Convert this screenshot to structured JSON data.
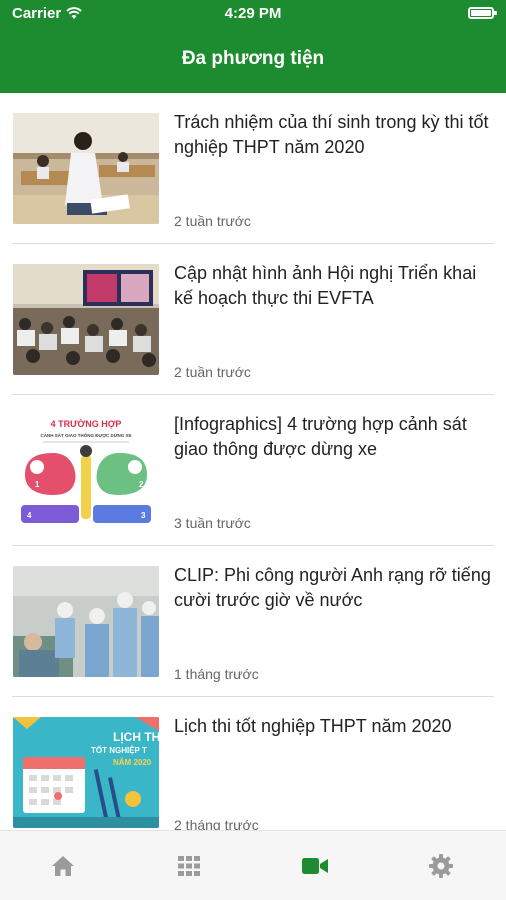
{
  "status_bar": {
    "carrier": "Carrier",
    "time": "4:29 PM"
  },
  "header": {
    "title": "Đa phương tiện"
  },
  "articles": [
    {
      "title": "Trách nhiệm của thí sinh trong kỳ thi tốt nghiệp THPT năm 2020",
      "age": "2 tuần trước"
    },
    {
      "title": "Cập nhật hình ảnh Hội nghị Triển khai kế hoạch thực thi EVFTA",
      "age": "2 tuần trước"
    },
    {
      "title": "[Infographics] 4 trường hợp cảnh sát giao thông được dừng xe",
      "age": "3 tuần trước",
      "thumb_text": {
        "heading": "4 TRƯỜNG HỢP",
        "subheading": "CẢNH SÁT GIAO THÔNG ĐƯỢC DỪNG XE",
        "n1": "1",
        "n2": "2",
        "n3": "3",
        "n4": "4"
      }
    },
    {
      "title": "CLIP: Phi công người Anh rạng rỡ tiếng cười trước giờ về nước",
      "age": "1 tháng trước"
    },
    {
      "title": "Lịch thi tốt nghiệp THPT năm 2020",
      "age": "2 tháng trước",
      "thumb_text": {
        "line1": "LỊCH TH",
        "line2": "TỐT NGHIỆP T",
        "line3": "NĂM 2020"
      }
    }
  ],
  "tabbar": {
    "tabs": [
      {
        "icon": "home-icon",
        "active": false
      },
      {
        "icon": "grid-icon",
        "active": false
      },
      {
        "icon": "video-camera-icon",
        "active": true
      },
      {
        "icon": "gear-icon",
        "active": false
      }
    ],
    "active_color": "#1d8b2f",
    "inactive_color": "#9b9b9b"
  },
  "colors": {
    "brand": "#1d8b2f"
  }
}
